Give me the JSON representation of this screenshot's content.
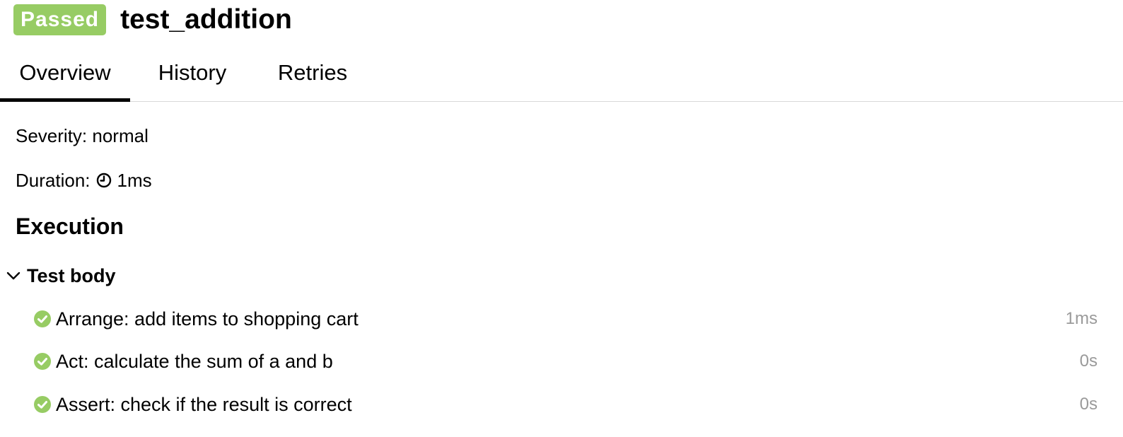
{
  "header": {
    "status": "Passed",
    "status_color": "#97cc64",
    "title": "test_addition"
  },
  "tabs": [
    {
      "label": "Overview",
      "active": true
    },
    {
      "label": "History",
      "active": false
    },
    {
      "label": "Retries",
      "active": false
    }
  ],
  "overview": {
    "severity_text": "Severity: normal",
    "duration_label": "Duration:",
    "duration_icon": "clock-icon",
    "duration_value": "1ms"
  },
  "execution": {
    "title": "Execution",
    "group": {
      "title": "Test body",
      "expanded": true,
      "steps": [
        {
          "label": "Arrange: add items to shopping cart",
          "time": "1ms",
          "status": "passed"
        },
        {
          "label": "Act: calculate the sum of a and b",
          "time": "0s",
          "status": "passed"
        },
        {
          "label": "Assert: check if the result is correct",
          "time": "0s",
          "status": "passed"
        }
      ]
    }
  },
  "colors": {
    "passed": "#97cc64",
    "muted_text": "#9a9a9a",
    "divider": "#d9d9d9"
  }
}
